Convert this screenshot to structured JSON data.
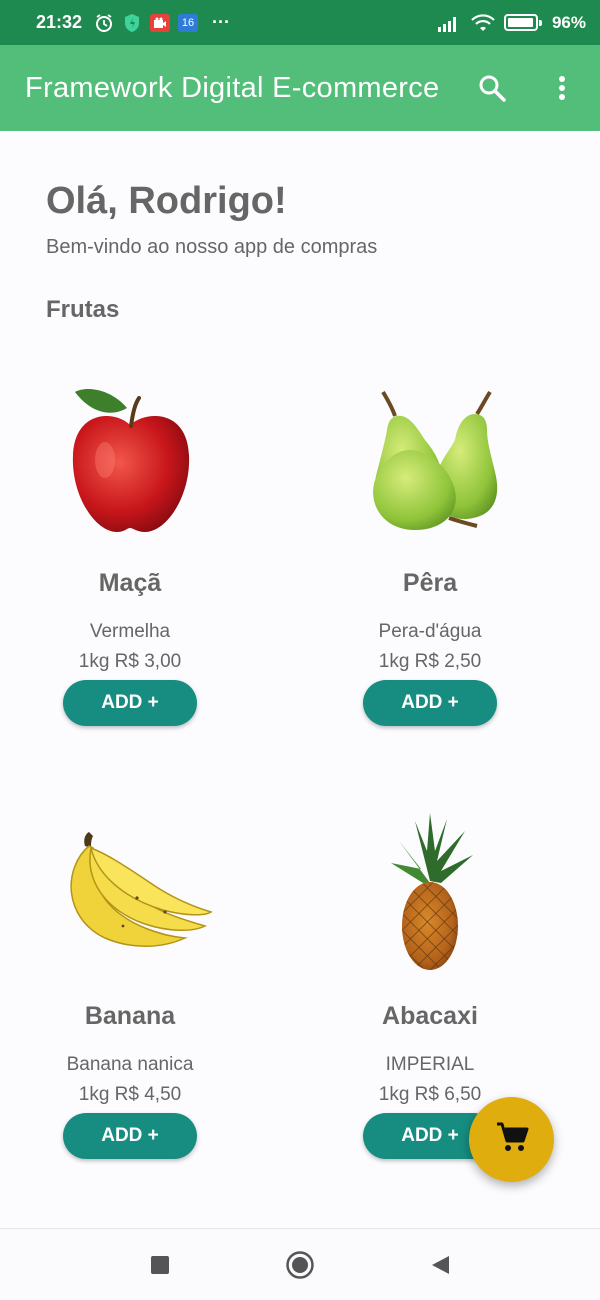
{
  "status_bar": {
    "time": "21:32",
    "notification_badge": "16",
    "more": "···",
    "battery": "96%",
    "battery_level": 0.96
  },
  "app_bar": {
    "title": "Framework Digital E-commerce",
    "icons": [
      "search-icon",
      "more-vert-icon"
    ]
  },
  "colors": {
    "status_bar": "#1f8a4f",
    "app_bar": "#52be7a",
    "add_button": "#168d80",
    "fab": "#e0ad0e"
  },
  "main": {
    "greeting": "Olá, Rodrigo!",
    "subtitle": "Bem-vindo ao nosso app de compras",
    "section_title": "Frutas",
    "products": [
      {
        "name": "Maçã",
        "description": "Vermelha",
        "price": "1kg R$ 3,00",
        "button": "ADD +",
        "image": "apple"
      },
      {
        "name": "Pêra",
        "description": "Pera-d'água",
        "price": "1kg R$ 2,50",
        "button": "ADD +",
        "image": "pear"
      },
      {
        "name": "Banana",
        "description": "Banana nanica",
        "price": "1kg R$ 4,50",
        "button": "ADD +",
        "image": "banana"
      },
      {
        "name": "Abacaxi",
        "description": "IMPERIAL",
        "price": "1kg R$ 6,50",
        "button": "ADD +",
        "image": "pineapple"
      }
    ]
  },
  "fab": {
    "icon": "cart-icon"
  },
  "nav_bar": {
    "icons": [
      "recents-square-icon",
      "home-circle-icon",
      "back-triangle-icon"
    ]
  }
}
